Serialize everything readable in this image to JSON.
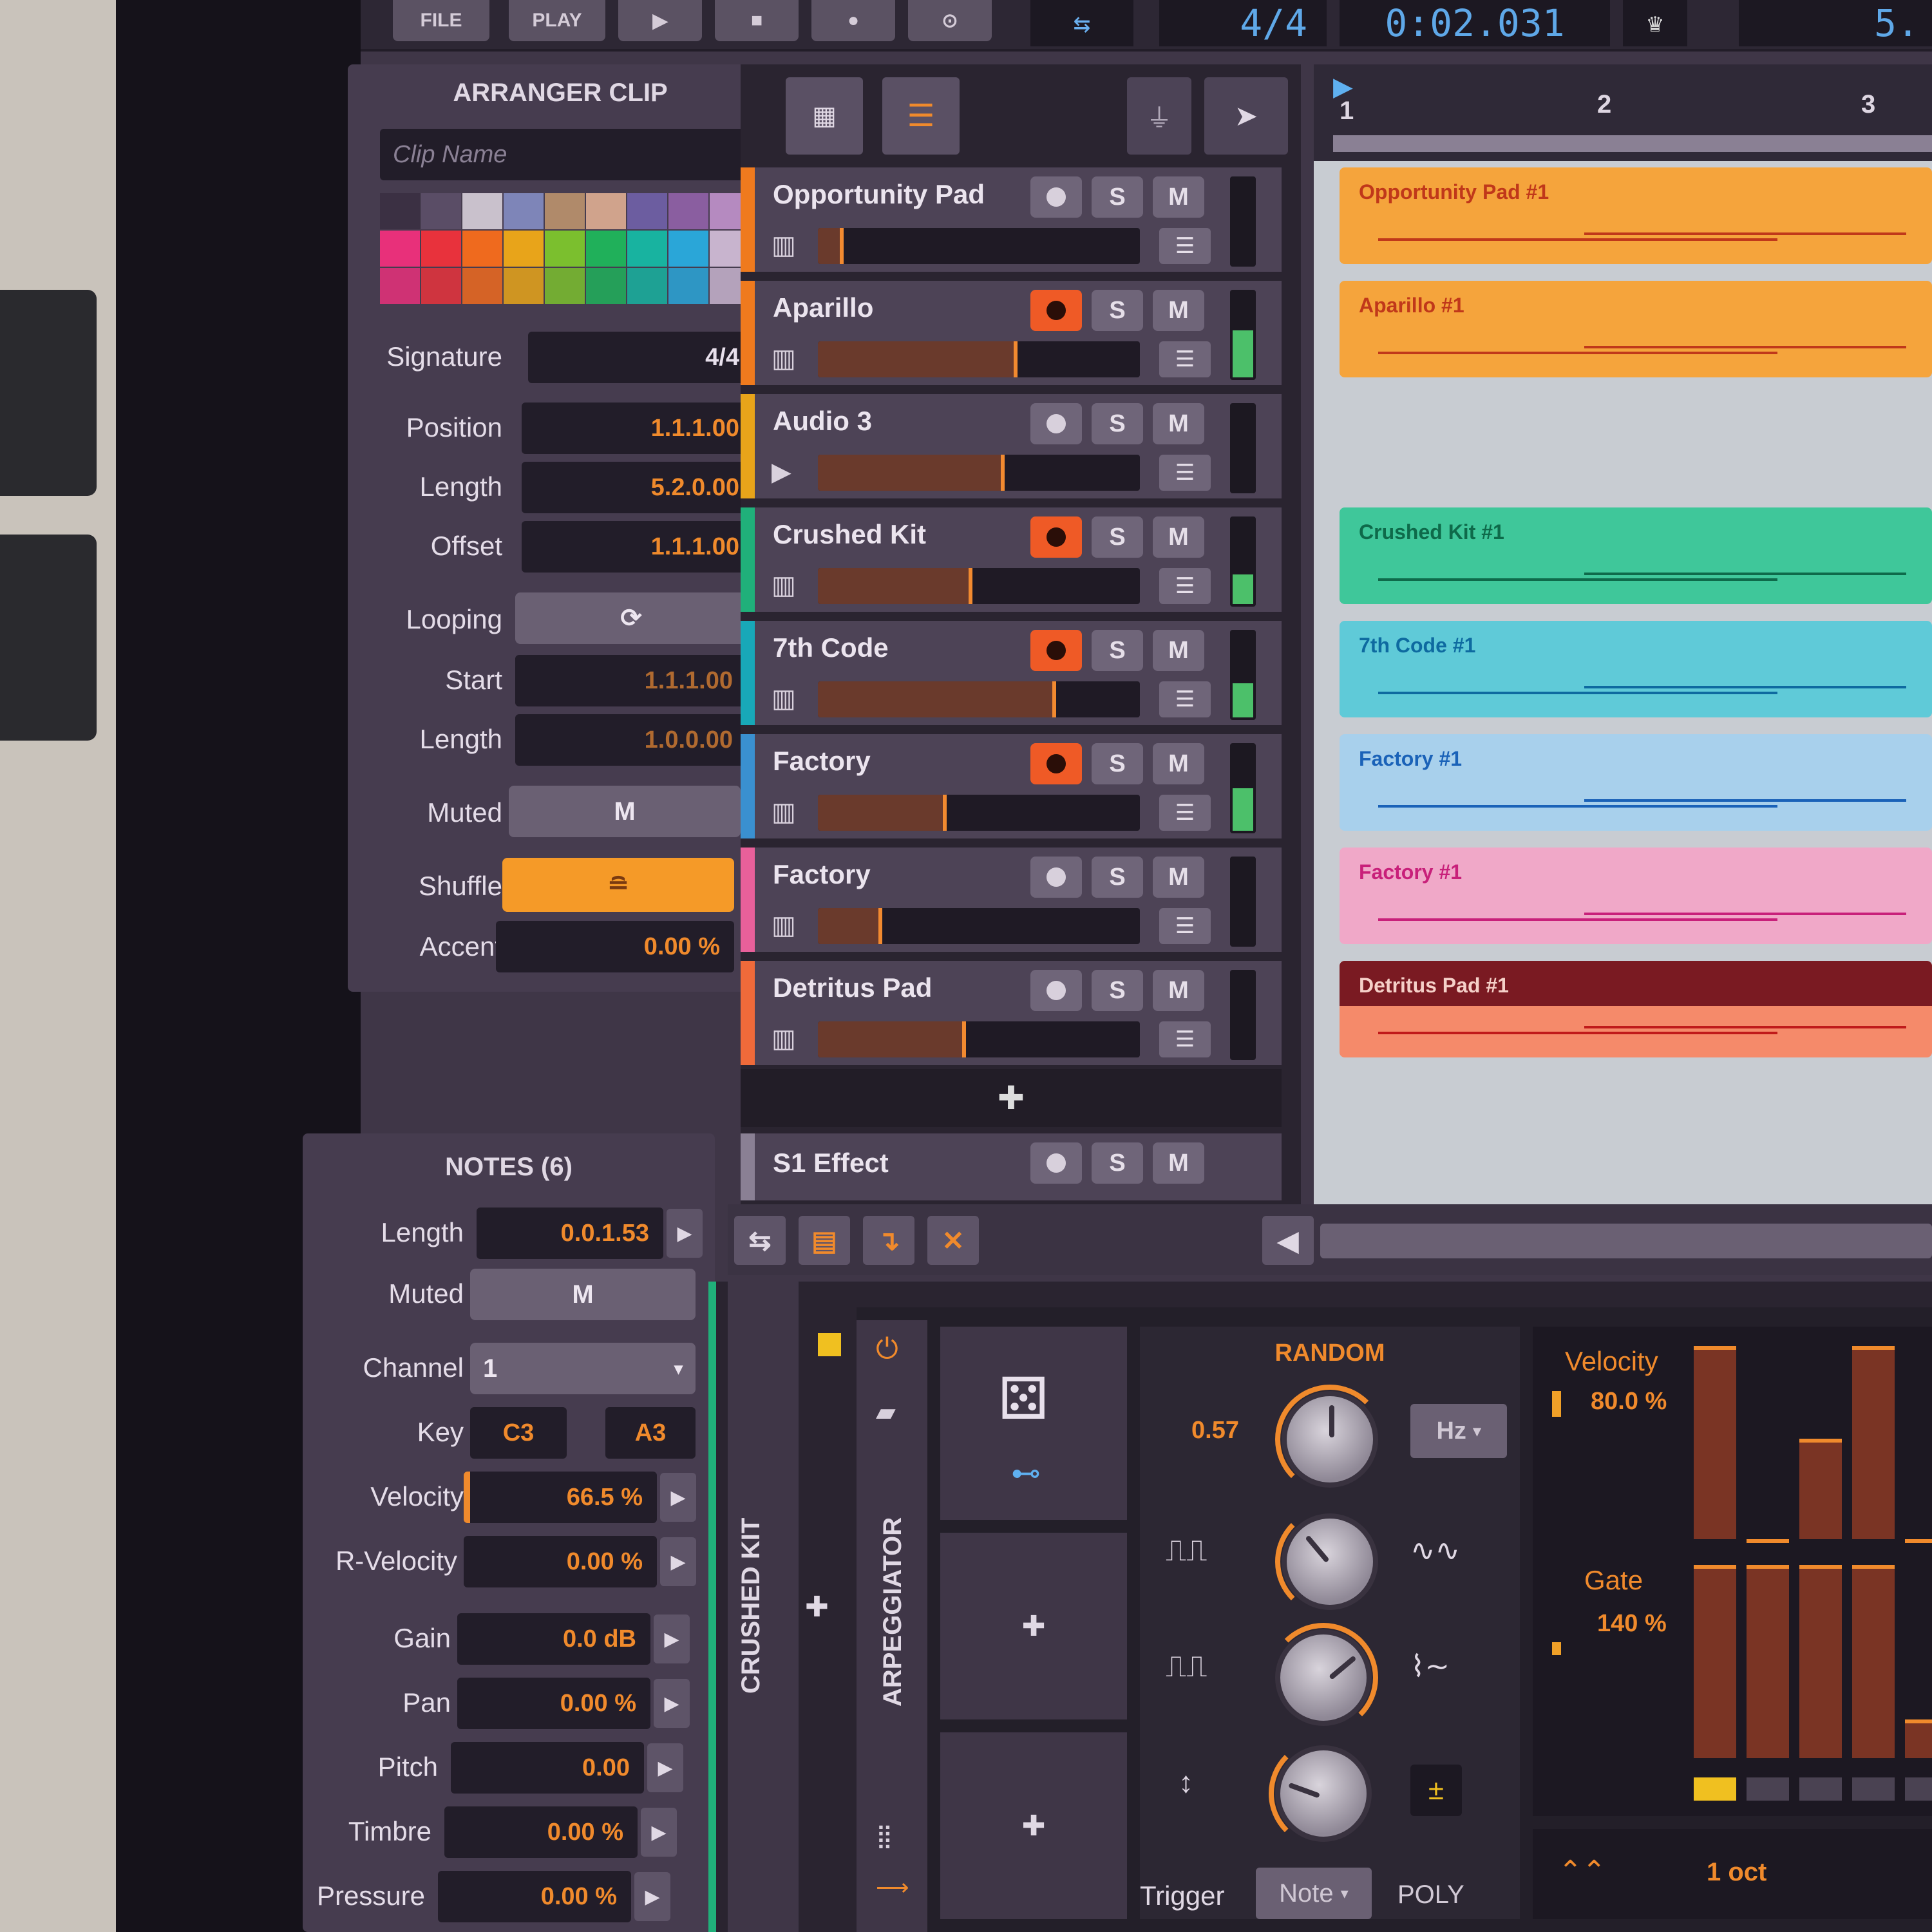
{
  "transport": {
    "file": "FILE",
    "play": "PLAY",
    "timesig": "4/4",
    "time": "0:02.031",
    "tempo": "5."
  },
  "inspector": {
    "title": "ARRANGER CLIP",
    "clip_name_placeholder": "Clip Name",
    "signature_label": "Signature",
    "signature_value": "4/4",
    "position_label": "Position",
    "position_value": "1.1.1.00",
    "length_label": "Length",
    "length_value": "5.2.0.00",
    "offset_label": "Offset",
    "offset_value": "1.1.1.00",
    "looping_label": "Looping",
    "start_label": "Start",
    "start_value": "1.1.1.00",
    "loop_length_label": "Length",
    "loop_length_value": "1.0.0.00",
    "muted_label": "Muted",
    "muted_button": "M",
    "shuffle_label": "Shuffle",
    "accent_label": "Accent",
    "accent_value": "0.00 %",
    "palette_top": [
      "#3b3043",
      "#5a4d66",
      "#c9c1cc",
      "#7e85b8",
      "#b08a6a",
      "#d0a38c",
      "#6c5da0",
      "#8a5ea0",
      "#b58ac0"
    ],
    "palette_bottom": [
      "#e8307a",
      "#e8323c",
      "#ef6a1e",
      "#e8a41a",
      "#7bbf2e",
      "#20b05a",
      "#18b3a0",
      "#2aa6d8",
      "#c8b4ce"
    ]
  },
  "notes": {
    "title": "NOTES (6)",
    "length_label": "Length",
    "length_value": "0.0.1.53",
    "muted_label": "Muted",
    "muted_button": "M",
    "channel_label": "Channel",
    "channel_value": "1",
    "key_label": "Key",
    "key_low": "C3",
    "key_high": "A3",
    "velocity_label": "Velocity",
    "velocity_value": "66.5 %",
    "rvelocity_label": "R-Velocity",
    "rvelocity_value": "0.00 %",
    "gain_label": "Gain",
    "gain_value": "0.0 dB",
    "pan_label": "Pan",
    "pan_value": "0.00 %",
    "pitch_label": "Pitch",
    "pitch_value": "0.00",
    "timbre_label": "Timbre",
    "timbre_value": "0.00 %",
    "pressure_label": "Pressure",
    "pressure_value": "0.00 %"
  },
  "tracks": [
    {
      "name": "Opportunity Pad",
      "color": "#ef7a1e",
      "armed": false,
      "type": "instrument",
      "level": 0.08,
      "meter": 0
    },
    {
      "name": "Aparillo",
      "color": "#ef7a1e",
      "armed": true,
      "type": "instrument",
      "level": 0.62,
      "meter": 0.55
    },
    {
      "name": "Audio 3",
      "color": "#e8a41a",
      "armed": false,
      "type": "audio",
      "level": 0.58,
      "meter": 0
    },
    {
      "name": "Crushed Kit",
      "color": "#20b07a",
      "armed": true,
      "type": "instrument",
      "level": 0.48,
      "meter": 0.35
    },
    {
      "name": "7th Code",
      "color": "#18a8b8",
      "armed": true,
      "type": "instrument",
      "level": 0.74,
      "meter": 0.4
    },
    {
      "name": "Factory",
      "color": "#3a90d0",
      "armed": true,
      "type": "instrument",
      "level": 0.4,
      "meter": 0.5
    },
    {
      "name": "Factory",
      "color": "#e8609a",
      "armed": false,
      "type": "instrument",
      "level": 0.2,
      "meter": 0
    },
    {
      "name": "Detritus Pad",
      "color": "#ef6a3a",
      "armed": false,
      "type": "instrument",
      "level": 0.46,
      "meter": 0
    }
  ],
  "effect_track": {
    "name": "S1 Effect"
  },
  "track_buttons": {
    "solo": "S",
    "mute": "M"
  },
  "ruler": [
    "1",
    "2",
    "3"
  ],
  "clips": [
    {
      "name": "Opportunity Pad #1",
      "bg": "#f5a43c",
      "fg": "#c0381a"
    },
    {
      "name": "Aparillo #1",
      "bg": "#f5a43c",
      "fg": "#c0381a"
    },
    {
      "name": "Crushed Kit #1",
      "bg": "#3fc79a",
      "fg": "#0e6a4a"
    },
    {
      "name": "7th Code #1",
      "bg": "#5fcad8",
      "fg": "#0e6aa0"
    },
    {
      "name": "Factory #1",
      "bg": "#a8d0ec",
      "fg": "#1a62b8"
    },
    {
      "name": "Factory #1",
      "bg": "#f0a8c8",
      "fg": "#c8207a"
    },
    {
      "name": "Detritus Pad #1",
      "bg": "#f58a6a",
      "fg": "#c01a1a",
      "header": "#7a1a22"
    }
  ],
  "device": {
    "track_label": "CRUSHED KIT",
    "device_label": "ARPEGGIATOR",
    "random_label": "RANDOM",
    "rate_value": "0.57",
    "unit": "Hz",
    "velocity_label": "Velocity",
    "velocity_value": "80.0 %",
    "gate_label": "Gate",
    "gate_value": "140 %",
    "trigger_label": "Trigger",
    "trigger_value": "Note",
    "mode_value": "POLY",
    "octave_value": "1 oct",
    "step_velocity": [
      1.0,
      0.0,
      0.52,
      1.0,
      0.0
    ],
    "step_gate": [
      1.0,
      1.0,
      1.0,
      1.0,
      0.2
    ]
  }
}
